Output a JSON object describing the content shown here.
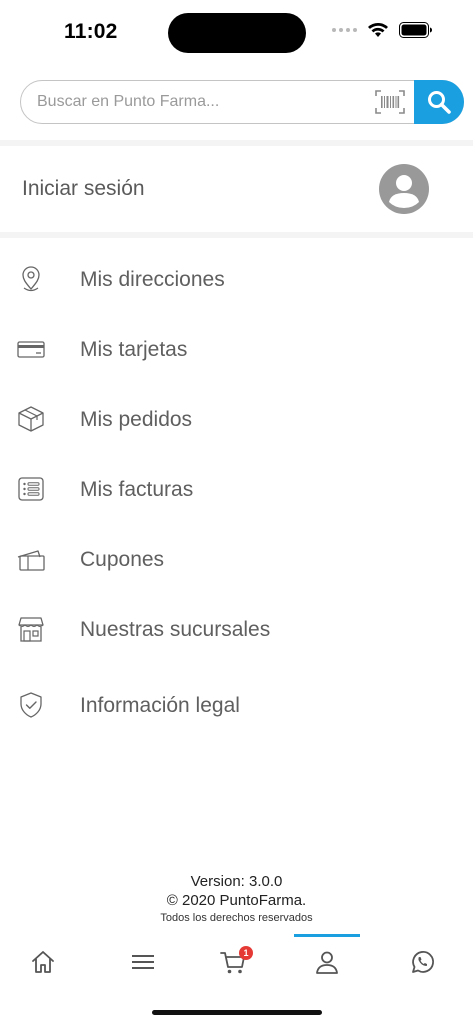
{
  "status_bar": {
    "time": "11:02"
  },
  "search": {
    "placeholder": "Buscar en Punto Farma...",
    "barcode_icon": "barcode-icon",
    "button_icon": "search-icon",
    "button_color": "#1a9fe0"
  },
  "account": {
    "login_label": "Iniciar sesión",
    "avatar_icon": "user-avatar-icon"
  },
  "menu": {
    "items": [
      {
        "label": "Mis direcciones",
        "icon": "location-pin-icon"
      },
      {
        "label": "Mis tarjetas",
        "icon": "credit-card-icon"
      },
      {
        "label": "Mis pedidos",
        "icon": "package-icon"
      },
      {
        "label": "Mis facturas",
        "icon": "invoice-icon"
      },
      {
        "label": "Cupones",
        "icon": "coupon-icon"
      },
      {
        "label": "Nuestras sucursales",
        "icon": "store-icon"
      },
      {
        "label": "Información legal",
        "icon": "shield-check-icon"
      }
    ]
  },
  "footer": {
    "version": "Version: 3.0.0",
    "copyright": "© 2020 PuntoFarma.",
    "rights": "Todos los derechos reservados"
  },
  "tab_bar": {
    "tabs": [
      {
        "icon": "home-icon"
      },
      {
        "icon": "menu-icon"
      },
      {
        "icon": "cart-icon",
        "badge": "1"
      },
      {
        "icon": "profile-icon",
        "active": true
      },
      {
        "icon": "whatsapp-icon"
      }
    ],
    "accent_color": "#1a9fe0",
    "badge_color": "#e53935"
  }
}
